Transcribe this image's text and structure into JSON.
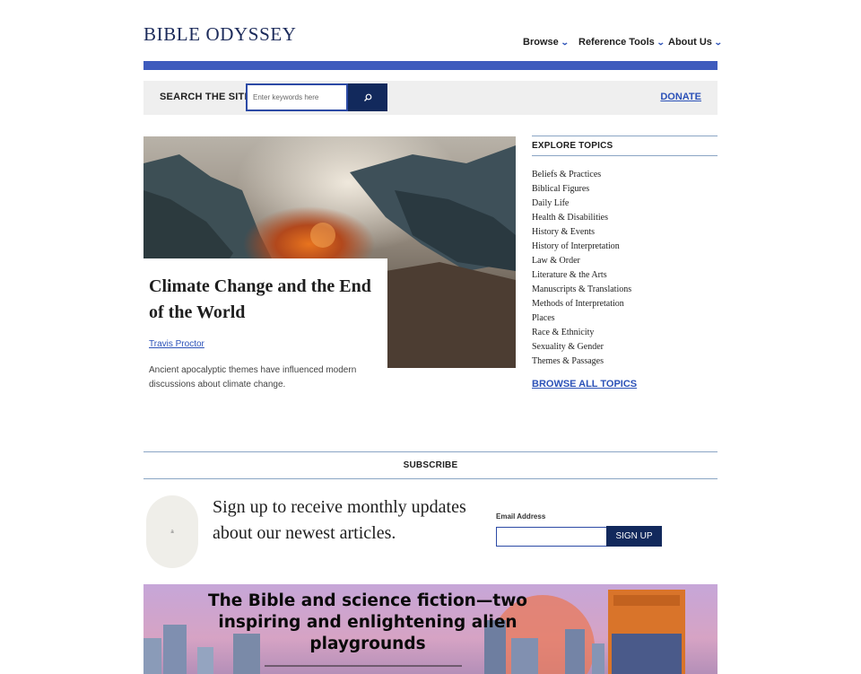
{
  "header": {
    "logo": "BIBLE ODYSSEY",
    "nav": [
      {
        "label": "Browse"
      },
      {
        "label": "Reference Tools"
      },
      {
        "label": "About Us"
      }
    ]
  },
  "search": {
    "label": "SEARCH THE SITE",
    "placeholder": "Enter keywords here",
    "button_icon": "search-icon",
    "donate": "DONATE"
  },
  "featured": {
    "title": "Climate Change and the End of the World",
    "author": "Travis Proctor",
    "description": "Ancient apocalyptic themes have influenced modern discussions about climate change."
  },
  "topics": {
    "heading": "EXPLORE TOPICS",
    "items": [
      "Beliefs & Practices",
      "Biblical Figures",
      "Daily Life",
      "Health & Disabilities",
      "History & Events",
      "History of Interpretation",
      "Law & Order",
      "Literature & the Arts",
      "Manuscripts & Translations",
      "Methods of Interpretation",
      "Places",
      "Race & Ethnicity",
      "Sexuality & Gender",
      "Themes & Passages"
    ],
    "browse_all": "BROWSE ALL TOPICS"
  },
  "subscribe": {
    "heading": "SUBSCRIBE",
    "icon_text": "a",
    "text": "Sign up to receive monthly updates about our newest articles.",
    "email_label": "Email Address",
    "email_value": "",
    "button": "SIGN UP"
  },
  "banner": {
    "text": "The Bible and science fiction—two inspiring and enlightening alien playgrounds"
  },
  "colors": {
    "accent": "#3e5bbd",
    "navy": "#12295c",
    "link": "#2c52b8"
  }
}
